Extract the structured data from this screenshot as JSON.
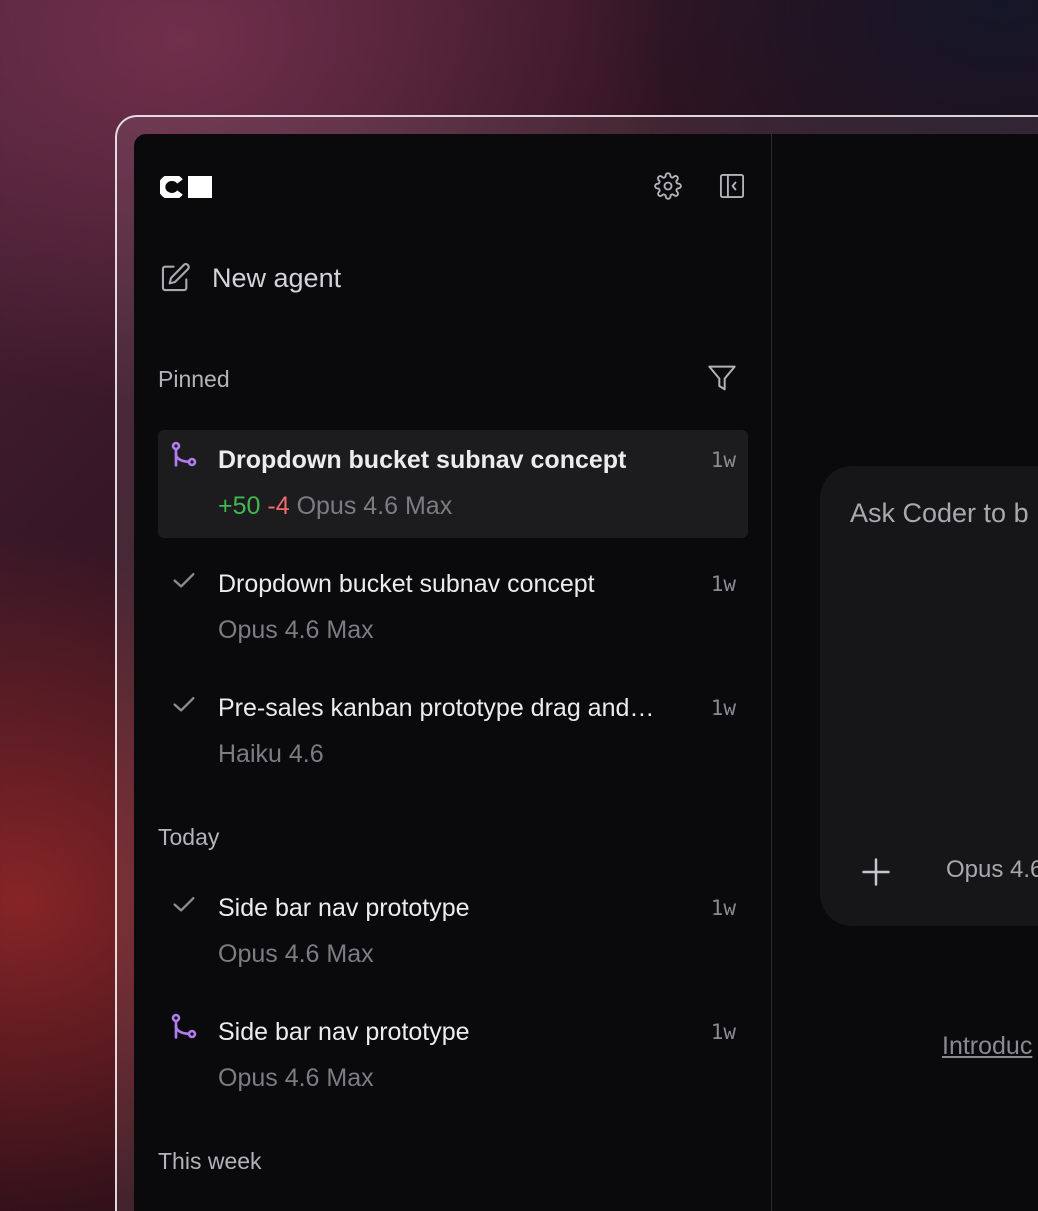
{
  "app": {
    "logo_text": "C",
    "settings_icon": "gear-icon",
    "collapse_icon": "sidebar-collapse-icon"
  },
  "sidebar": {
    "new_agent_label": "New agent",
    "sections": {
      "pinned": "Pinned",
      "today": "Today",
      "this_week": "This week"
    },
    "items": [
      {
        "title": "Dropdown bucket subnav concept",
        "time": "1w",
        "additions": "+50",
        "deletions": "-4",
        "model": "Opus 4.6 Max",
        "status_icon": "branch-icon",
        "active": true
      },
      {
        "title": "Dropdown bucket subnav concept",
        "time": "1w",
        "model": "Opus 4.6 Max",
        "status_icon": "check-icon"
      },
      {
        "title": "Pre-sales kanban prototype drag and…",
        "time": "1w",
        "model": "Haiku 4.6",
        "status_icon": "check-icon"
      },
      {
        "title": "Side bar nav prototype",
        "time": "1w",
        "model": "Opus 4.6 Max",
        "status_icon": "check-icon"
      },
      {
        "title": "Side bar nav prototype",
        "time": "1w",
        "model": "Opus 4.6 Max",
        "status_icon": "branch-icon"
      }
    ]
  },
  "main": {
    "prompt_placeholder": "Ask Coder to b",
    "model_label": "Opus 4.6",
    "intro_link": "Introduc"
  },
  "colors": {
    "accent_purple": "#b07cf0",
    "additions": "#3fb950",
    "deletions": "#f06a6a"
  }
}
